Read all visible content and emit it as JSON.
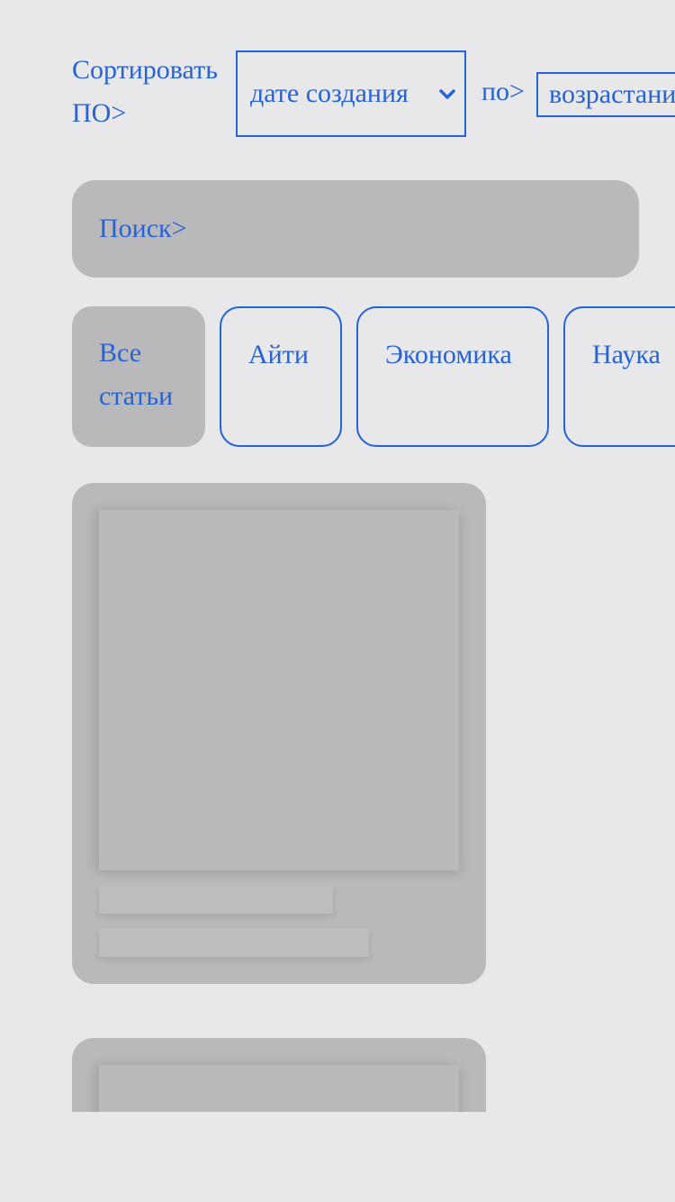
{
  "sort": {
    "label_line1": "Сортировать",
    "label_line2": "ПО>",
    "field_value": "дате создания",
    "order_label": "по>",
    "order_value": "возрастанию"
  },
  "search": {
    "label": "Поиск>"
  },
  "categories": [
    {
      "label_line1": "Все",
      "label_line2": "статьи",
      "active": true
    },
    {
      "label": "Айти",
      "active": false
    },
    {
      "label": "Экономика",
      "active": false
    },
    {
      "label": "Наука",
      "active": false
    }
  ],
  "icons": {
    "select_arrow": "chevron-down-icon"
  },
  "colors": {
    "accent": "#2563d9",
    "background": "#e8e8ea",
    "skeleton": "#b9b9bb"
  }
}
